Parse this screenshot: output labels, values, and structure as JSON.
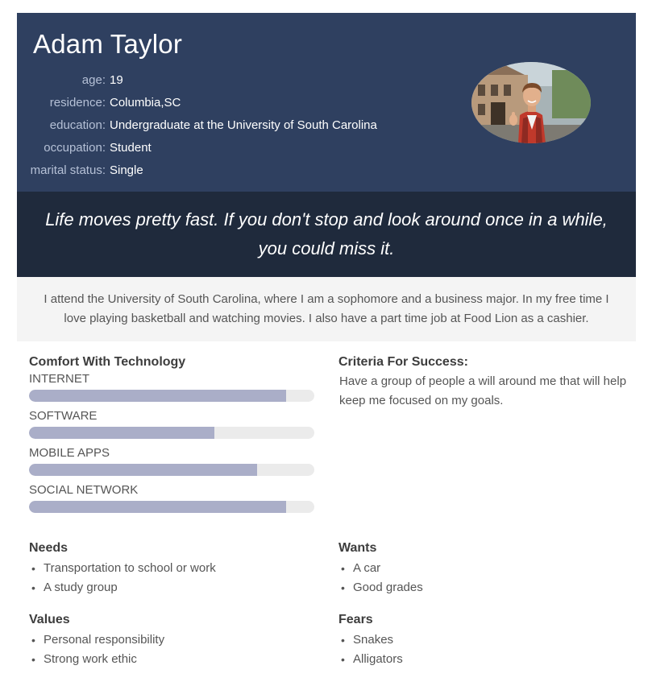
{
  "persona": {
    "name": "Adam Taylor",
    "facts": [
      {
        "label": "age:",
        "value": "19"
      },
      {
        "label": "residence:",
        "value": "Columbia,SC"
      },
      {
        "label": "education:",
        "value": "Undergraduate at the University of South Carolina"
      },
      {
        "label": "occupation:",
        "value": "Student"
      },
      {
        "label": "marital status:",
        "value": "Single"
      }
    ],
    "quote": "Life moves pretty fast. If you don't stop and look around once in a while, you could miss it.",
    "bio": "I attend the University of South Carolina, where I am a sophomore and a business major. In my free time I love playing basketball and watching movies. I also have a part time job at Food Lion as a cashier."
  },
  "technology": {
    "title": "Comfort With Technology",
    "skills": [
      {
        "label": "INTERNET",
        "level": 0.9
      },
      {
        "label": "SOFTWARE",
        "level": 0.65
      },
      {
        "label": "MOBILE APPS",
        "level": 0.8
      },
      {
        "label": "SOCIAL NETWORK",
        "level": 0.9
      }
    ]
  },
  "success": {
    "title": "Criteria For Success:",
    "text": "Have a group of people a will around me that will help keep me focused on my goals."
  },
  "needs": {
    "title": "Needs",
    "items": [
      "Transportation to school or work",
      "A study group"
    ]
  },
  "wants": {
    "title": "Wants",
    "items": [
      "A car",
      "Good grades"
    ]
  },
  "values": {
    "title": "Values",
    "items": [
      "Personal responsibility",
      "Strong work ethic"
    ]
  },
  "fears": {
    "title": "Fears",
    "items": [
      "Snakes",
      "Alligators"
    ]
  },
  "colors": {
    "header_bg": "#2f4060",
    "quote_bg": "#1f2a3c",
    "bio_bg": "#f4f4f4",
    "bar_fill": "#aaaec8",
    "bar_track": "#ebebeb"
  }
}
